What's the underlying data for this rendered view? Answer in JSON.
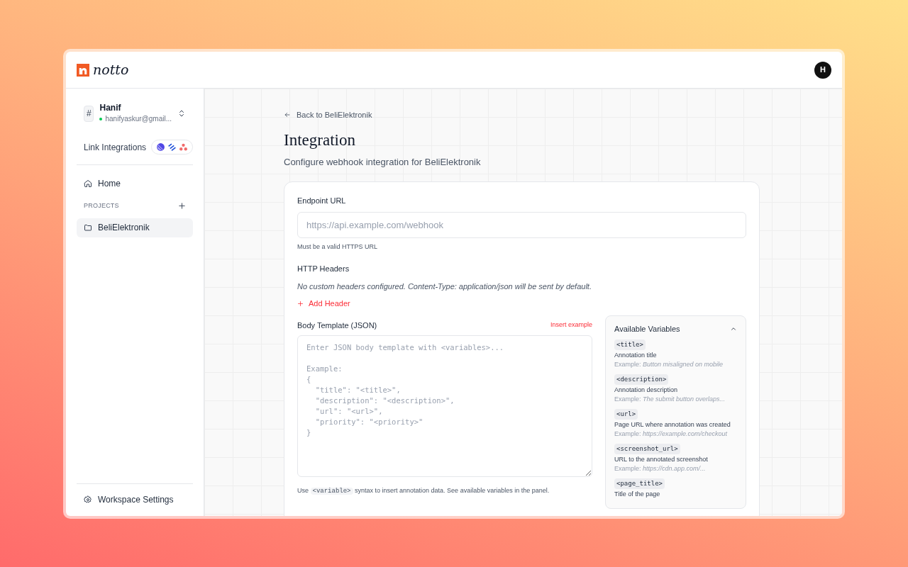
{
  "header": {
    "logo_text": "notto",
    "avatar": "H"
  },
  "sidebar": {
    "account": {
      "badge": "#",
      "name": "Hanif",
      "email": "hanifyaskur@gmail..."
    },
    "link_integrations": "Link Integrations",
    "nav": [
      {
        "label": "Home",
        "selected": false
      }
    ],
    "projects_label": "PROJECTS",
    "projects": [
      {
        "label": "BeliElektronik",
        "selected": true
      }
    ],
    "footer": "Workspace Settings"
  },
  "main": {
    "back": "Back to BeliElektronik",
    "title": "Integration",
    "subtitle": "Configure webhook integration for BeliElektronik",
    "endpoint": {
      "label": "Endpoint URL",
      "placeholder": "https://api.example.com/webhook",
      "hint": "Must be a valid HTTPS URL"
    },
    "headers": {
      "label": "HTTP Headers",
      "empty": "No custom headers configured. Content-Type: application/json will be sent by default.",
      "add": "Add Header"
    },
    "body": {
      "label": "Body Template (JSON)",
      "insert": "Insert example",
      "placeholder": "Enter JSON body template with <variables>...\n\nExample:\n{\n  \"title\": \"<title>\",\n  \"description\": \"<description>\",\n  \"url\": \"<url>\",\n  \"priority\": \"<priority>\"\n}",
      "hint_before": "Use",
      "hint_code": "<variable>",
      "hint_after": "syntax to insert annotation data. See available variables in the panel."
    },
    "variables": {
      "title": "Available Variables",
      "expanded": true,
      "items": [
        {
          "name": "<title>",
          "description": "Annotation title",
          "example_label": "Example:",
          "example": "Button misaligned on mobile"
        },
        {
          "name": "<description>",
          "description": "Annotation description",
          "example_label": "Example:",
          "example": "The submit button overlaps..."
        },
        {
          "name": "<url>",
          "description": "Page URL where annotation was created",
          "example_label": "Example:",
          "example": "https://example.com/checkout"
        },
        {
          "name": "<screenshot_url>",
          "description": "URL to the annotated screenshot",
          "example_label": "Example:",
          "example": "https://cdn.app.com/..."
        },
        {
          "name": "<page_title>",
          "description": "Title of the page"
        }
      ]
    }
  }
}
